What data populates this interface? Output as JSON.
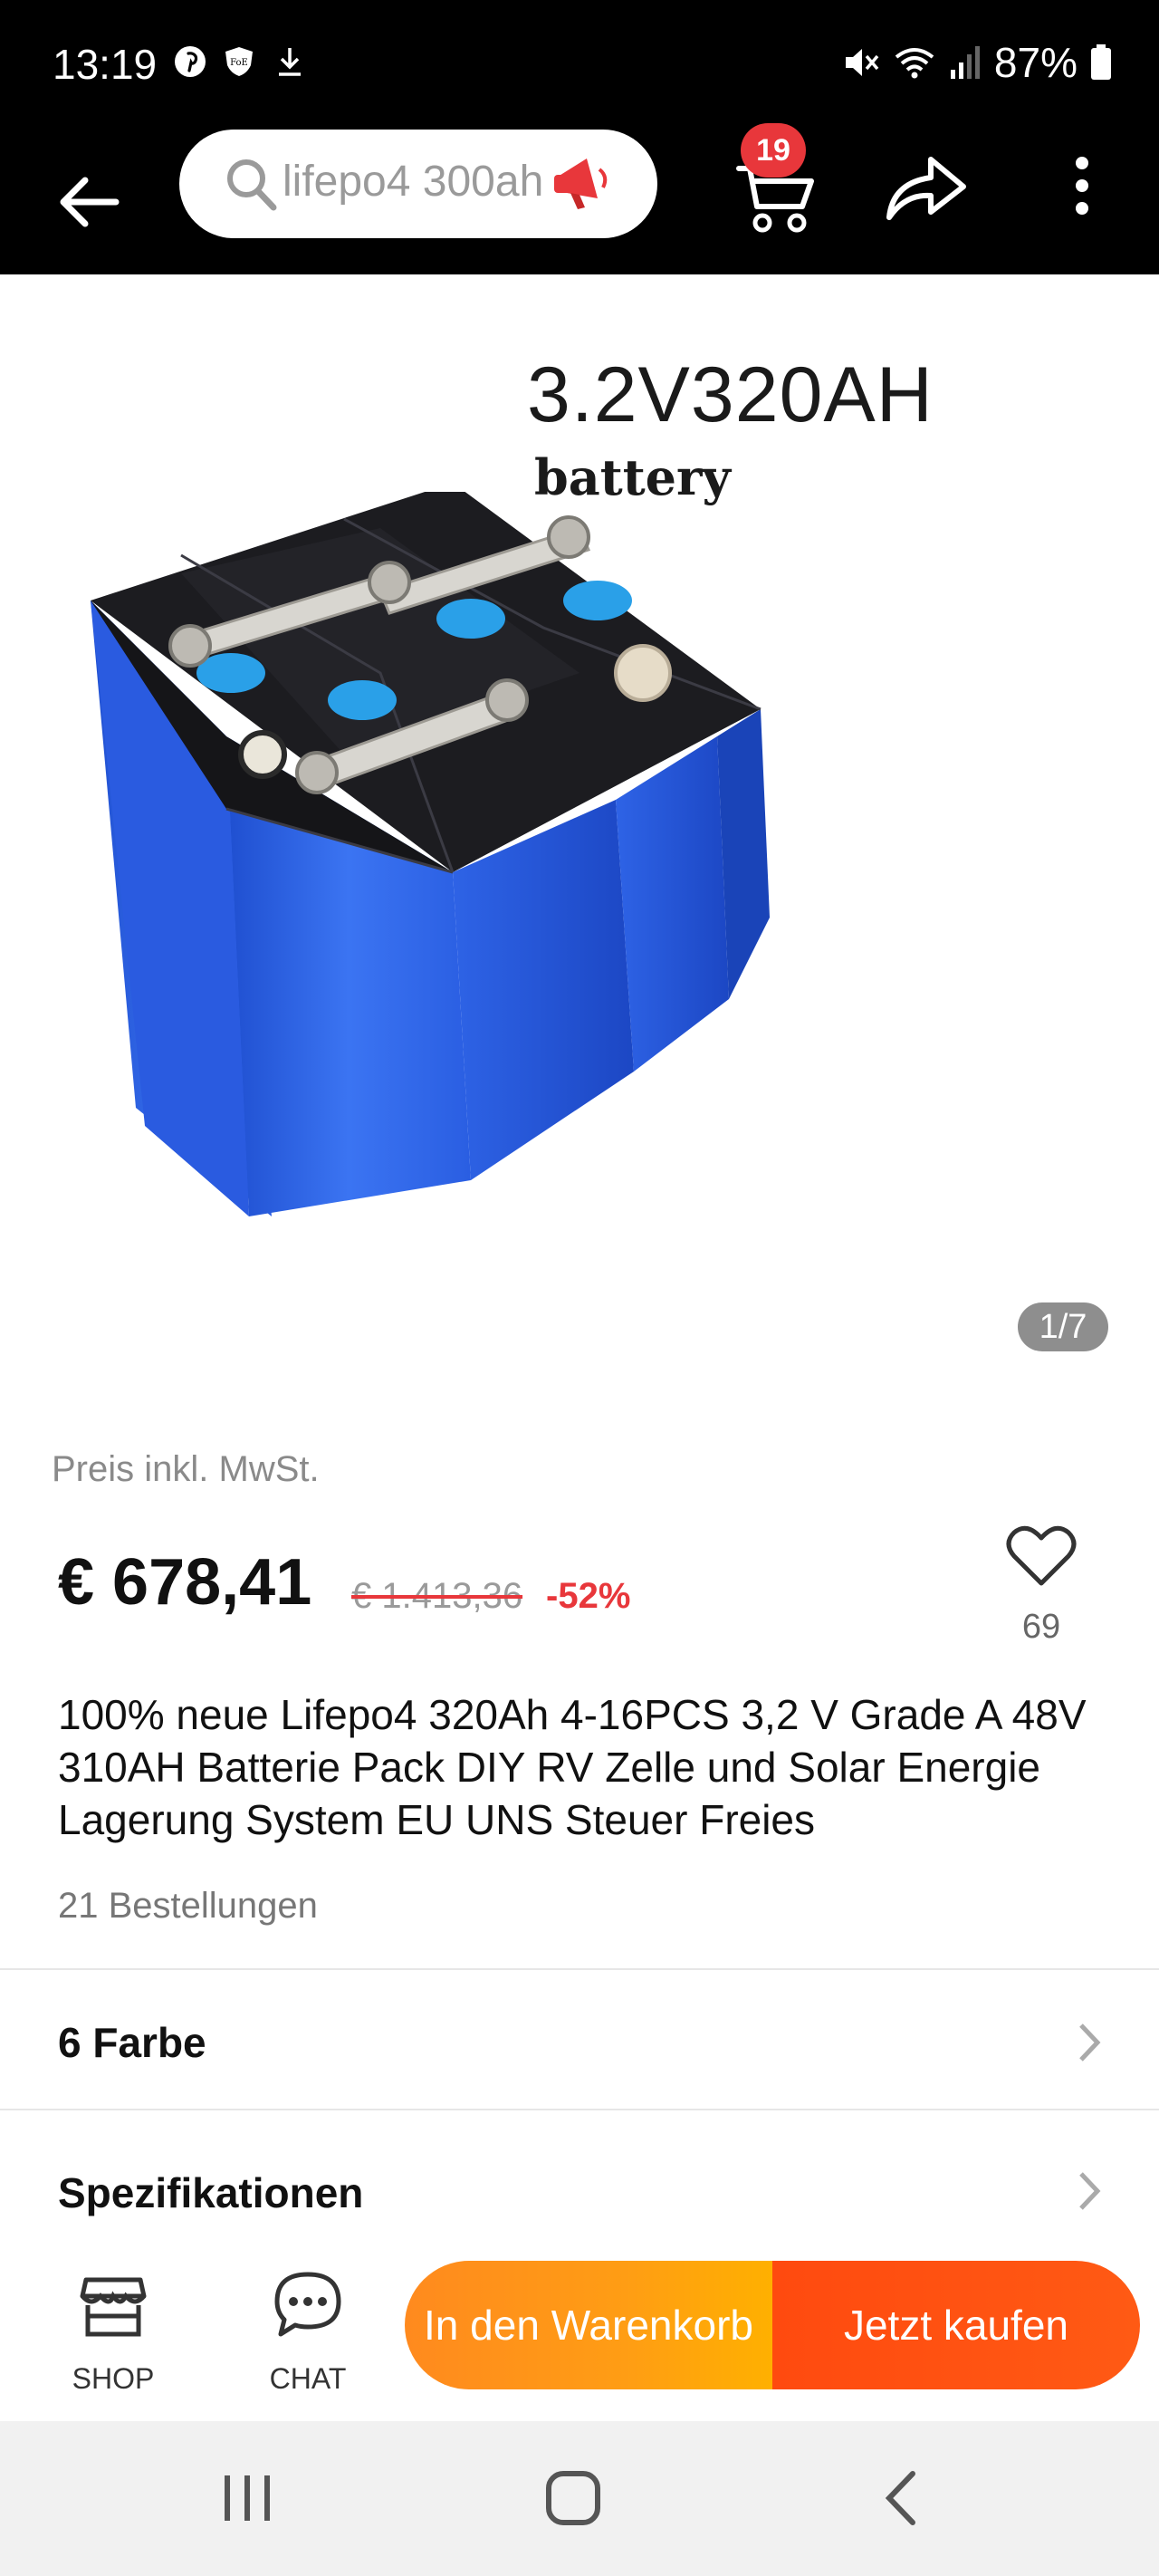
{
  "status_bar": {
    "time": "13:19",
    "battery": "87%"
  },
  "search": {
    "query": "lifepo4 300ah"
  },
  "cart": {
    "badge_count": "19"
  },
  "gallery": {
    "headline": "3.2V320AH",
    "subline": "battery",
    "counter": "1/7"
  },
  "product": {
    "tax_note": "Preis inkl. MwSt.",
    "price": "€ 678,41",
    "old_price": "€ 1.413,36",
    "discount": "-52%",
    "wishlist_count": "69",
    "title": "100% neue Lifepo4 320Ah 4-16PCS 3,2 V Grade A 48V 310AH Batterie Pack DIY RV Zelle und Solar Energie Lagerung System EU UNS Steuer Freies",
    "orders": "21 Bestellungen"
  },
  "sections": {
    "color": "6 Farbe",
    "specs": "Spezifikationen"
  },
  "actions": {
    "shop": "SHOP",
    "chat": "CHAT",
    "add_to_cart": "In den Warenkorb",
    "buy_now": "Jetzt kaufen"
  },
  "colors": {
    "accent_red": "#e8373b",
    "cart_orange": "#ff9d14",
    "buy_orange": "#ff5a14",
    "battery_blue": "#2b5fe0"
  },
  "icons": [
    "pinterest-icon",
    "shield-icon",
    "download-icon",
    "mute-icon",
    "wifi-icon",
    "signal-icon",
    "battery-icon",
    "back-arrow-icon",
    "search-icon",
    "megaphone-icon",
    "cart-icon",
    "share-icon",
    "more-vert-icon",
    "heart-icon",
    "chevron-right-icon",
    "store-icon",
    "chat-bubble-icon",
    "recents-icon",
    "home-icon",
    "back-nav-icon"
  ]
}
